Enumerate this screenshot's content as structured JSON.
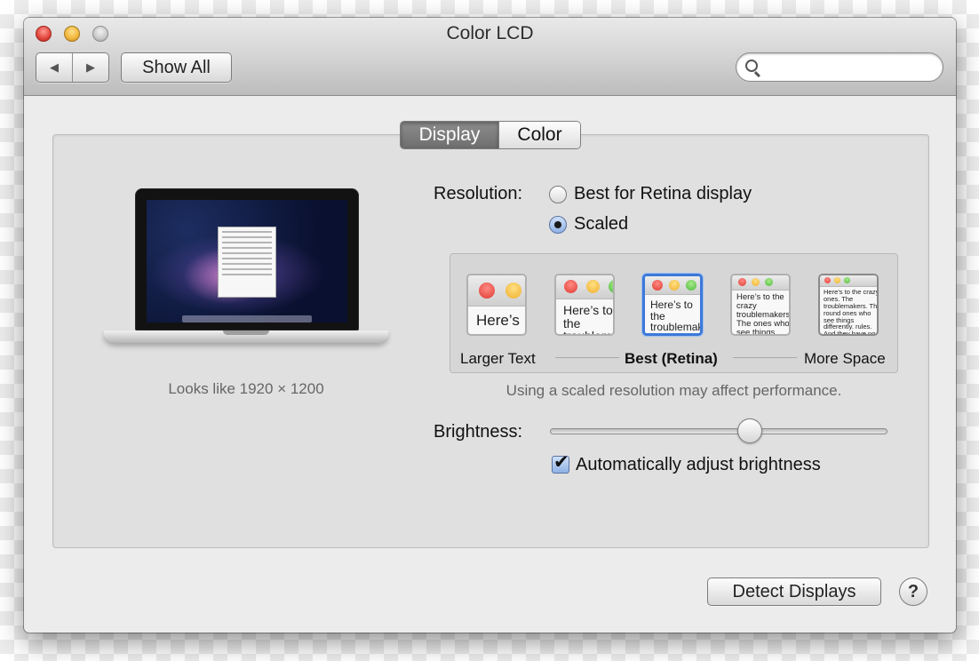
{
  "window": {
    "title": "Color LCD"
  },
  "toolbar": {
    "back_icon": "◀",
    "forward_icon": "▶",
    "show_all_label": "Show All",
    "search_placeholder": ""
  },
  "tabs": [
    {
      "label": "Display",
      "selected": true
    },
    {
      "label": "Color",
      "selected": false
    }
  ],
  "display": {
    "looks_like": "Looks like 1920 × 1200"
  },
  "resolution": {
    "label": "Resolution:",
    "options": [
      {
        "label": "Best for Retina display",
        "selected": false
      },
      {
        "label": "Scaled",
        "selected": true
      }
    ]
  },
  "scaled_options": {
    "items": [
      {
        "preview_text": "Here’s",
        "selected": false
      },
      {
        "preview_text": "Here’s to the troublemakers.",
        "selected": false
      },
      {
        "preview_text": "Here’s to the troublemakers, ones who",
        "selected": true
      },
      {
        "preview_text": "Here’s to the crazy troublemakers. The ones who see things rules. And they have",
        "selected": false
      },
      {
        "preview_text": "Here’s to the crazy ones. The troublemakers. The round ones who see things differently. rules. And they have no can quote them, disagree them. About the only thing Because they change things",
        "selected": false
      }
    ],
    "left_label": "Larger Text",
    "center_label": "Best (Retina)",
    "right_label": "More Space",
    "note": "Using a scaled resolution may affect performance."
  },
  "brightness": {
    "label": "Brightness:",
    "level": 0.6,
    "auto_label": "Automatically adjust brightness",
    "auto_checked": true
  },
  "footer": {
    "detect_label": "Detect Displays",
    "help_label": "?"
  },
  "colors": {
    "selection_blue": "#3d79d8",
    "tab_selected": "#7a7a7a"
  }
}
